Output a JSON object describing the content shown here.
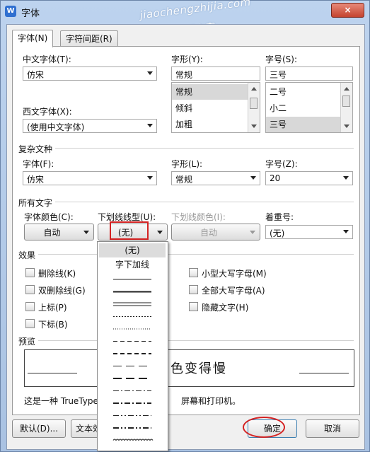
{
  "window": {
    "title": "字体",
    "app_icon": "W",
    "close_label": "×",
    "watermark_line1": "jiaochengzhijia.com",
    "watermark_line2": "教程之家"
  },
  "tabs": [
    {
      "label": "字体(N)",
      "active": true
    },
    {
      "label": "字符间距(R)",
      "active": false
    }
  ],
  "chinese_font": {
    "label": "中文字体(T):",
    "value": "仿宋"
  },
  "western_font": {
    "label": "西文字体(X):",
    "value": "(使用中文字体)"
  },
  "style": {
    "label": "字形(Y):",
    "value": "常规",
    "options": [
      "常规",
      "倾斜",
      "加粗"
    ],
    "selected": "常规"
  },
  "size": {
    "label": "字号(S):",
    "value": "三号",
    "options": [
      "二号",
      "小二",
      "三号"
    ],
    "selected": "三号"
  },
  "complex": {
    "section": "复杂文种",
    "font_label": "字体(F):",
    "font_value": "仿宋",
    "style_label": "字形(L):",
    "style_value": "常规",
    "size_label": "字号(Z):",
    "size_value": "20"
  },
  "all_text": {
    "section": "所有文字",
    "color_label": "字体颜色(C):",
    "color_value": "自动",
    "underline_label": "下划线线型(U):",
    "underline_value": "(无)",
    "underline_color_label": "下划线颜色(I):",
    "underline_color_value": "自动",
    "emphasis_label": "着重号:",
    "emphasis_value": "(无)"
  },
  "effects": {
    "section": "效果",
    "left": [
      "删除线(K)",
      "双删除线(G)",
      "上标(P)",
      "下标(B)"
    ],
    "right": [
      "小型大写字母(M)",
      "全部大写字母(A)",
      "隐藏文字(H)"
    ]
  },
  "preview": {
    "section": "预览",
    "sample": "日色变得慢",
    "note_start": "这是一种 TrueType",
    "note_end": "屏幕和打印机。"
  },
  "buttons": {
    "default": "默认(D)...",
    "text_effect": "文本效",
    "ok": "确定",
    "cancel": "取消"
  },
  "underline_dropdown": {
    "items": [
      "(无)",
      "字下加线"
    ],
    "selected": "(无)",
    "line_styles": [
      "single",
      "thick",
      "double",
      "dotted",
      "dotted-fine",
      "dashed",
      "dashed-thick",
      "long-dash",
      "long-dash-thick",
      "dash-dot",
      "dash-dot-thick",
      "dash-dot-dot",
      "dash-dot-dot-thick",
      "wave"
    ]
  },
  "annotation_color": "#d42222"
}
